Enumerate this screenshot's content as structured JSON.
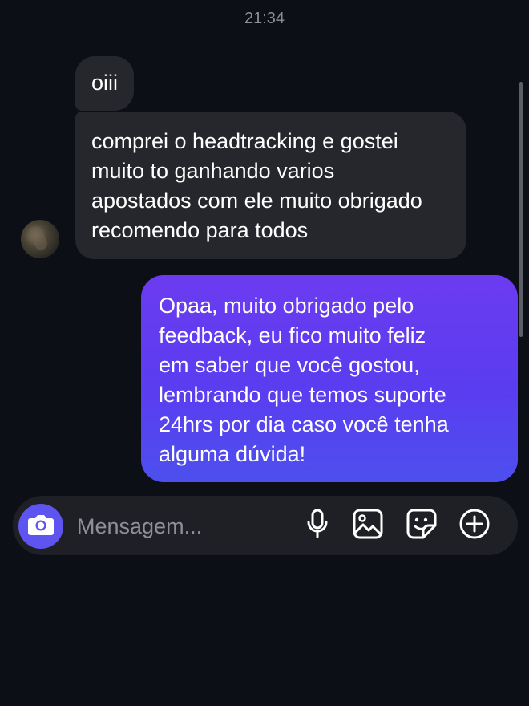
{
  "status": {
    "time": "21:34"
  },
  "conversation": {
    "incoming": [
      {
        "lines": [
          "oiii"
        ]
      },
      {
        "lines": [
          "comprei o headtracking e gostei",
          "muito to ganhando varios",
          "apostados com ele muito obrigado",
          "recomendo para todos"
        ]
      }
    ],
    "outgoing": [
      {
        "lines": [
          "Opaa, muito obrigado pelo",
          "feedback, eu fico muito feliz",
          "em saber que você gostou,",
          "lembrando que temos suporte",
          "24hrs por dia caso você tenha",
          "alguma dúvida!"
        ]
      }
    ]
  },
  "composer": {
    "placeholder": "Mensagem...",
    "value": "",
    "icons": [
      "camera-icon",
      "microphone-icon",
      "gallery-icon",
      "sticker-icon",
      "plus-icon"
    ]
  },
  "colors": {
    "background": "#0d0f16",
    "incoming_bubble": "#26272c",
    "outgoing_gradient_top": "#6c3bf0",
    "outgoing_gradient_bottom": "#4d4fee",
    "accent": "#5e54ef"
  }
}
